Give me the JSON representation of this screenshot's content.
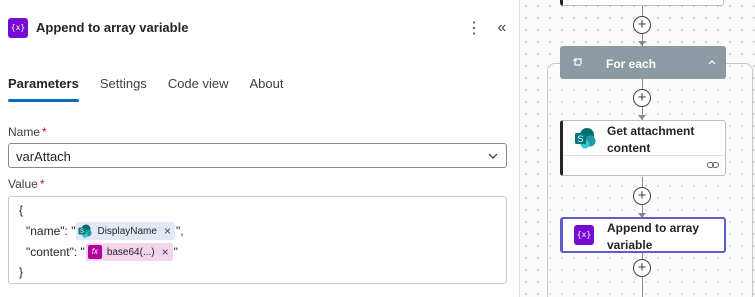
{
  "panel": {
    "icon_text": "{x}",
    "title": "Append to array variable",
    "more_label": "⋮",
    "collapse_label": "«"
  },
  "tabs": [
    {
      "label": "Parameters",
      "active": true
    },
    {
      "label": "Settings",
      "active": false
    },
    {
      "label": "Code view",
      "active": false
    },
    {
      "label": "About",
      "active": false
    }
  ],
  "name_field": {
    "label": "Name",
    "required_mark": "*",
    "value": "varAttach"
  },
  "value_field": {
    "label": "Value",
    "required_mark": "*",
    "lines": {
      "open_brace": "{",
      "name_prefix": "\"name\": \"",
      "name_token": "DisplayName",
      "name_suffix": "\",",
      "content_prefix": "\"content\": \"",
      "content_token_icon": "fx",
      "content_token": "base64(...)",
      "content_suffix": "\"",
      "close_brace": "}"
    },
    "token_remove": "×"
  },
  "canvas": {
    "add_label": "+",
    "foreach": {
      "title": "For each"
    },
    "cards": [
      {
        "title": "Get attachment content",
        "icon": "sharepoint-icon"
      },
      {
        "title": "Append to array variable",
        "icon": "variable-icon",
        "icon_text": "{x}"
      }
    ]
  },
  "colors": {
    "accent": "#0f6cbd",
    "variable_purple": "#770bd6",
    "required_red": "#c50f1f",
    "foreach_header": "#8b9aa3",
    "selected_border": "#5b5fc7"
  }
}
